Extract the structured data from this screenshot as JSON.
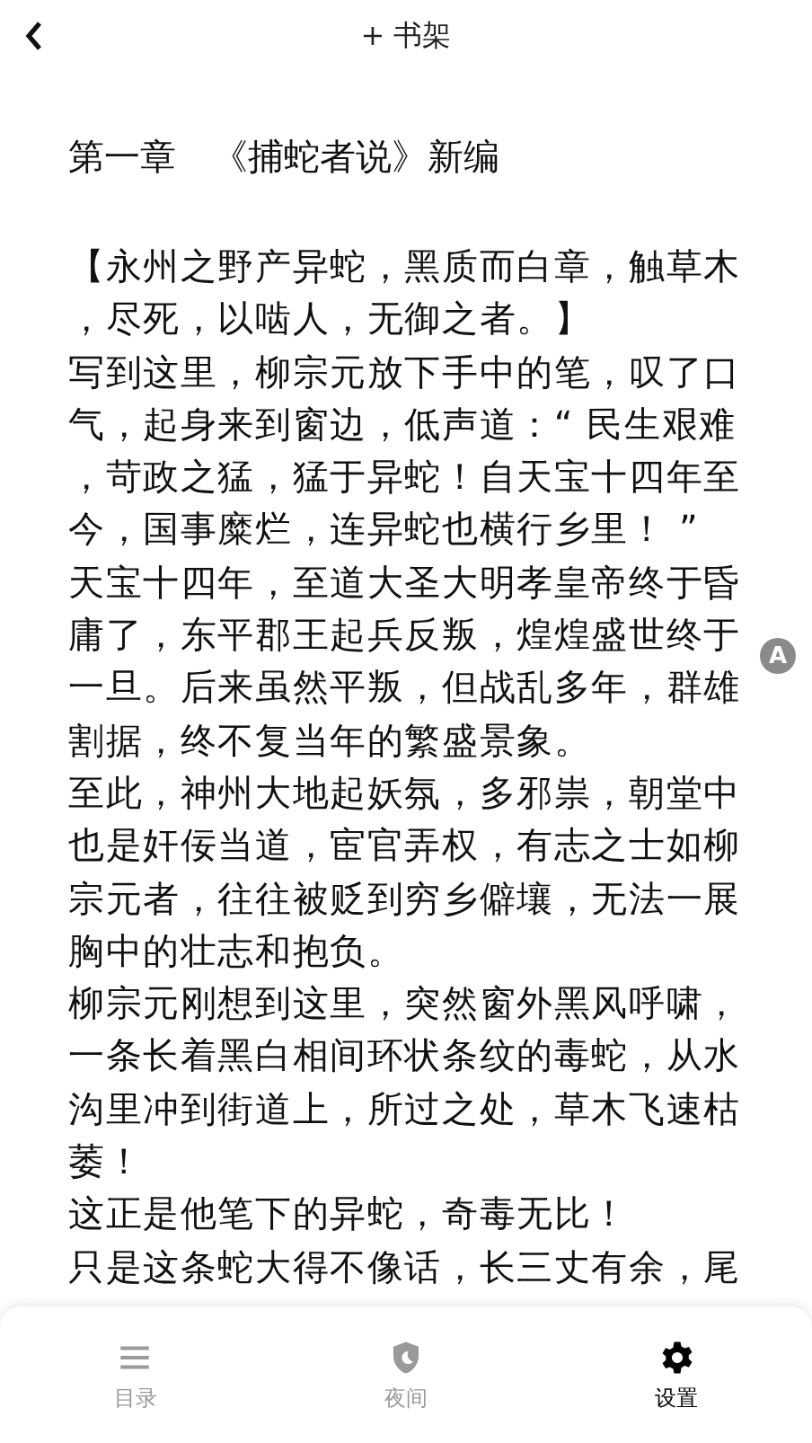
{
  "header": {
    "title": "+ 书架"
  },
  "chapter": {
    "title": "第一章　《捕蛇者说》新编",
    "paragraphs": [
      "【永州之野产异蛇，黑质而白章，触草木，尽死，以啮人，无御之者。】",
      "写到这里，柳宗元放下手中的笔，叹了口气，起身来到窗边，低声道：“ 民生艰难，苛政之猛，猛于异蛇！自天宝十四年至今，国事糜烂，连异蛇也横行乡里！ ”",
      "天宝十四年，至道大圣大明孝皇帝终于昏庸了，东平郡王起兵反叛，煌煌盛世终于一旦。后来虽然平叛，但战乱多年，群雄割据，终不复当年的繁盛景象。",
      "至此，神州大地起妖氛，多邪祟，朝堂中也是奸佞当道，宦官弄权，有志之士如柳宗元者，往往被贬到穷乡僻壤，无法一展胸中的壮志和抱负。",
      "柳宗元刚想到这里，突然窗外黑风呼啸，一条长着黑白相间环状条纹的毒蛇，从水沟里冲到街道上，所过之处，草木飞速枯萎！",
      "这正是他笔下的异蛇，奇毒无比！",
      "只是这条蛇大得不像话，长三丈有余，尾"
    ]
  },
  "font_button": {
    "label": "A"
  },
  "bottom_bar": [
    {
      "kind": "menu",
      "label": "目录",
      "selected": false
    },
    {
      "kind": "night",
      "label": "夜间",
      "selected": false
    },
    {
      "kind": "settings",
      "label": "设置",
      "selected": true
    }
  ]
}
